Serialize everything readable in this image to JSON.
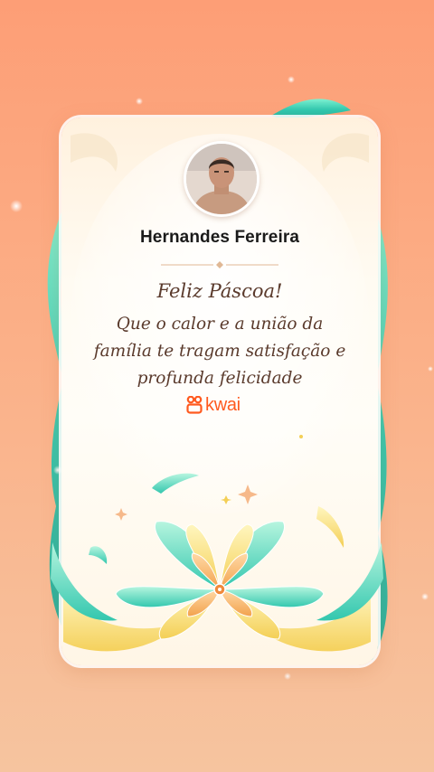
{
  "card": {
    "username": "Hernandes Ferreira",
    "greeting_title": "Feliz Páscoa!",
    "greeting_lines": [
      "Que o calor e a união da",
      "família te tragam satisfação e",
      "profunda felicidade"
    ],
    "brand_name": "kwai"
  },
  "colors": {
    "background_top": "#fd9e76",
    "background_bottom": "#f6c49f",
    "card_background": "#fffbf2",
    "text_dark": "#1a1a1a",
    "text_serif": "#5a3a2c",
    "brand_orange": "#ff5a1f",
    "ribbon_teal": "#2ec9b0",
    "ribbon_yellow": "#f7dc6f",
    "ribbon_mint": "#a8f0d8"
  },
  "icons": {
    "avatar": "user-profile-photo",
    "brand_logo": "kwai-logo-icon",
    "decoration": "easter-flower-ornament"
  }
}
